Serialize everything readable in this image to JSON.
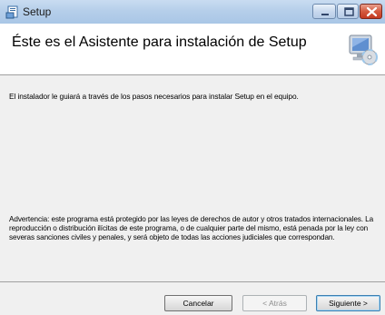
{
  "window": {
    "title": "Setup",
    "controls": {
      "minimize": "minimize-icon",
      "maximize": "maximize-icon",
      "close": "close-icon"
    }
  },
  "header": {
    "heading": "Éste es el Asistente para instalación de Setup",
    "icon": "computer-cd-icon"
  },
  "content": {
    "intro": "El instalador le guiará a través de los pasos necesarios para instalar Setup en el equipo.",
    "warning": "Advertencia: este programa está protegido por las leyes de derechos de autor y otros tratados internacionales. La reproducción o distribución ilícitas de este programa, o de cualquier parte del mismo, está penada por la ley con severas sanciones civiles y penales, y será objeto de todas las acciones judiciales que correspondan."
  },
  "buttons": {
    "cancel": "Cancelar",
    "back": "< Atrás",
    "next": "Siguiente >"
  },
  "colors": {
    "titlebar": "#b6cfea",
    "close_button": "#c43a21",
    "default_button_border": "#3c7fb1"
  }
}
